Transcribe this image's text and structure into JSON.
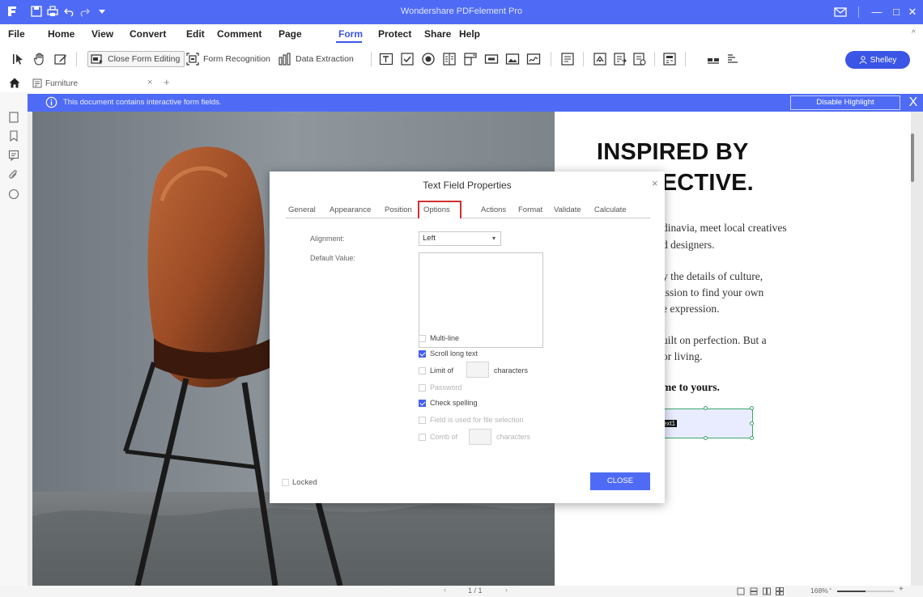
{
  "titlebar": {
    "title": "Wondershare PDFelement Pro"
  },
  "menu": {
    "items": [
      "File",
      "Home",
      "View",
      "Convert",
      "Edit",
      "Comment",
      "Page",
      "Form",
      "Protect",
      "Share",
      "Help"
    ],
    "active": "Form"
  },
  "ribbon": {
    "close_form_editing": "Close Form Editing",
    "form_recognition": "Form Recognition",
    "data_extraction": "Data Extraction",
    "user_label": "Shelley"
  },
  "tabbar": {
    "document_name": "Furniture",
    "close_glyph": "×",
    "add_glyph": "+"
  },
  "infobar": {
    "message": "This document contains interactive form fields.",
    "disable_label": "Disable Highlight",
    "close_glyph": "X"
  },
  "document": {
    "heading_line1": "INSPIRED BY",
    "heading_line2": "COLLECTIVE.",
    "lines": [
      "dinavia, meet local creatives",
      "d designers.",
      "y the details of culture,",
      "ission to find your own",
      "e expression.",
      "uilt on perfection. But a",
      "or living."
    ],
    "bold_line": "me to yours.",
    "field_label": "ext1"
  },
  "dialog": {
    "title": "Text Field Properties",
    "close_glyph": "×",
    "tabs": [
      "General",
      "Appearance",
      "Position",
      "Options",
      "Actions",
      "Format",
      "Validate",
      "Calculate"
    ],
    "active_tab": "Options",
    "alignment_label": "Alignment:",
    "alignment_value": "Left",
    "default_value_label": "Default Value:",
    "checkboxes": [
      {
        "label": "Multi-line",
        "checked": false,
        "enabled": true
      },
      {
        "label": "Scroll long text",
        "checked": true,
        "enabled": true
      },
      {
        "label": "Limit of",
        "checked": false,
        "enabled": true,
        "suffix": "characters"
      },
      {
        "label": "Password",
        "checked": false,
        "enabled": false
      },
      {
        "label": "Check spelling",
        "checked": true,
        "enabled": true
      },
      {
        "label": "Field is used for file selection",
        "checked": false,
        "enabled": false
      },
      {
        "label": "Comb of",
        "checked": false,
        "enabled": false,
        "suffix": "characters"
      }
    ],
    "locked_label": "Locked",
    "close_button": "CLOSE"
  },
  "statusbar": {
    "page": "1 / 1",
    "zoom": "168%"
  },
  "colors": {
    "accent": "#4f6bf5",
    "highlight_red": "#d23030",
    "field_border": "#3aa66a"
  }
}
